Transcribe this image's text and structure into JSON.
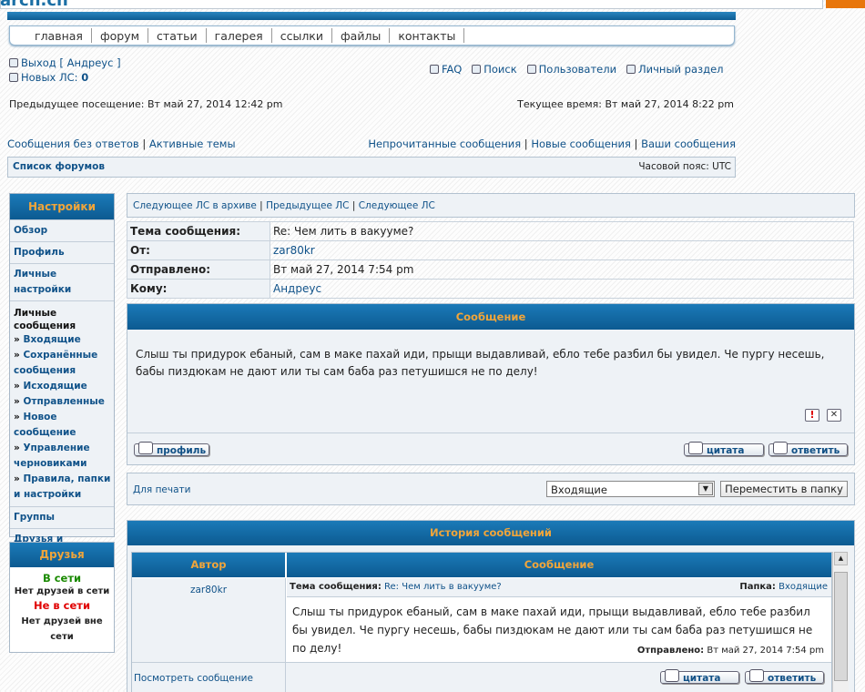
{
  "logo_text": "arcn.cn",
  "nav": [
    "главная",
    "форум",
    "статьи",
    "галерея",
    "ссылки",
    "файлы",
    "контакты"
  ],
  "user": {
    "logout_label": "Выход",
    "username": "Андреус",
    "new_pm_label": "Новых ЛС:",
    "new_pm_count": "0"
  },
  "toplinks": {
    "faq": "FAQ",
    "search": "Поиск",
    "users": "Пользователи",
    "ucp": "Личный раздел"
  },
  "visits": {
    "previous": "Предыдущее посещение: Вт май 27, 2014 12:42 pm",
    "current": "Текущее время: Вт май 27, 2014 8:22 pm"
  },
  "links_left": [
    "Сообщения без ответов",
    "Активные темы"
  ],
  "links_right": [
    "Непрочитанные сообщения",
    "Новые сообщения",
    "Ваши сообщения"
  ],
  "forum_list": "Список форумов",
  "timezone": "Часовой пояс: UTC",
  "sidebar": {
    "title": "Настройки",
    "overview": "Обзор",
    "profile": "Профиль",
    "prefs": "Личные настройки",
    "pm": "Личные сообщения",
    "pm_items": [
      "Входящие",
      "Сохранённые сообщения",
      "Исходящие",
      "Отправленные",
      "Новое сообщение",
      "Управление черновиками",
      "Правила, папки и настройки"
    ],
    "groups": "Группы",
    "friends_foes": "Друзья и недруги"
  },
  "friends": {
    "title": "Друзья",
    "online": "В сети",
    "no_online": "Нет друзей в сети",
    "offline": "Не в сети",
    "no_offline": "Нет друзей вне сети"
  },
  "pm_nav": [
    "Следующее ЛС в архиве",
    "Предыдущее ЛС",
    "Следующее ЛС"
  ],
  "header": {
    "subject_label": "Тема сообщения:",
    "subject": "Re: Чем лить в вакууме?",
    "from_label": "От:",
    "from": "zar80kr",
    "sent_label": "Отправлено:",
    "sent": "Вт май 27, 2014 7:54 pm",
    "to_label": "Кому:",
    "to": "Андреус"
  },
  "message": {
    "heading": "Сообщение",
    "body": "Слыш ты придурок ебаный, сам в маке пахай иди, прыщи выдавливай, ебло тебе разбил бы увидел. Че пургу несешь, бабы пиздюкам не дают или ты сам баба раз петушишся не по делу!",
    "report_icon": "!",
    "delete_icon": "✕",
    "profile_btn": "профиль",
    "quote_btn": "цитата",
    "reply_btn": "ответить"
  },
  "actions": {
    "print": "Для печати",
    "folder_selected": "Входящие",
    "move_btn": "Переместить в папку"
  },
  "history": {
    "heading": "История сообщений",
    "col_author": "Автор",
    "col_message": "Сообщение",
    "author": "zar80kr",
    "subject_label": "Тема сообщения:",
    "subject": "Re: Чем лить в вакууме?",
    "folder_label": "Папка:",
    "folder": "Входящие",
    "body": "Слыш ты придурок ебаный, сам в маке пахай иди, прыщи выдавливай, ебло тебе разбил бы увидел. Че пургу несешь, бабы пиздюкам не дают или ты сам баба раз петушишся не по делу!",
    "sent_label": "Отправлено:",
    "sent": "Вт май 27, 2014 7:54 pm",
    "view_link": "Посмотреть сообщение",
    "quote_btn": "цитата",
    "reply_btn": "ответить"
  },
  "colors": {
    "brand_blue": "#0c5a91",
    "accent_orange": "#f0a53a",
    "link": "#105289",
    "online": "#1a8a00",
    "offline": "#e00000"
  }
}
